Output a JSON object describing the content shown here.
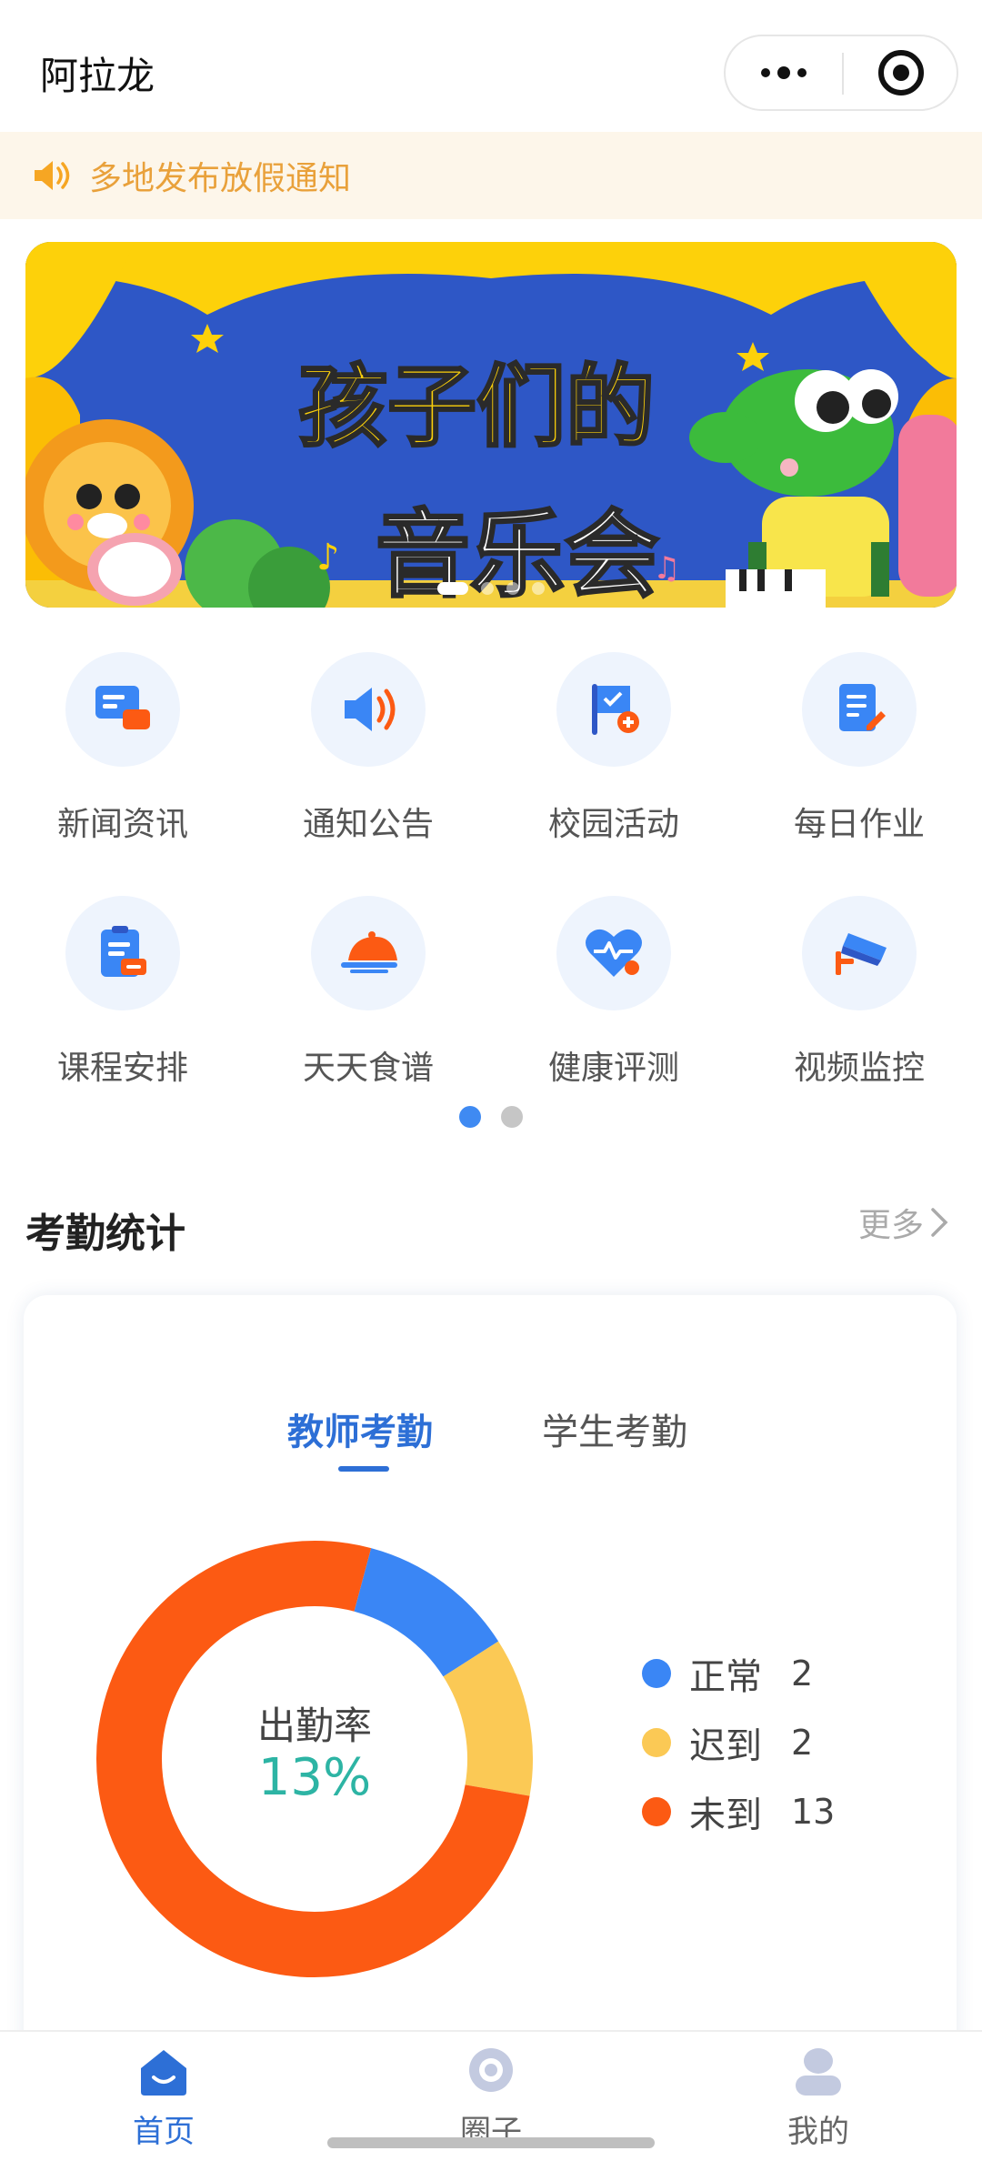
{
  "titlebar": {
    "title": "阿拉龙"
  },
  "notice": {
    "text": "多地发布放假通知"
  },
  "banner": {
    "title_line1": "孩子们的",
    "title_line2": "音乐会",
    "slide_count": 4,
    "active_slide": 1
  },
  "grid": {
    "items": [
      {
        "label": "新闻资讯",
        "icon": "news-chat-icon"
      },
      {
        "label": "通知公告",
        "icon": "megaphone-icon"
      },
      {
        "label": "校园活动",
        "icon": "flag-icon"
      },
      {
        "label": "每日作业",
        "icon": "homework-edit-icon"
      },
      {
        "label": "课程安排",
        "icon": "schedule-clipboard-icon"
      },
      {
        "label": "天天食谱",
        "icon": "food-dome-icon"
      },
      {
        "label": "健康评测",
        "icon": "heart-pulse-icon"
      },
      {
        "label": "视频监控",
        "icon": "cctv-camera-icon"
      }
    ],
    "pages": 2,
    "active_page": 1
  },
  "attendance": {
    "title": "考勤统计",
    "more_label": "更多",
    "tabs": [
      "教师考勤",
      "学生考勤"
    ],
    "active_tab": 0,
    "rate_label": "出勤率",
    "rate_value": "13%",
    "legend": [
      {
        "name": "正常",
        "value": "2",
        "color": "#3a86f5"
      },
      {
        "name": "迟到",
        "value": "2",
        "color": "#fbc955"
      },
      {
        "name": "未到",
        "value": "13",
        "color": "#fc5a13"
      }
    ]
  },
  "chart_data": {
    "type": "pie",
    "categories": [
      "正常",
      "迟到",
      "未到"
    ],
    "values": [
      2,
      2,
      13
    ],
    "colors": [
      "#3a86f5",
      "#fbc955",
      "#fc5a13"
    ],
    "center_label": "出勤率",
    "center_value": "13%"
  },
  "tabbar": {
    "items": [
      {
        "label": "首页",
        "icon": "home-icon",
        "active": true
      },
      {
        "label": "圈子",
        "icon": "circle-icon",
        "active": false
      },
      {
        "label": "我的",
        "icon": "profile-icon",
        "active": false
      }
    ]
  }
}
